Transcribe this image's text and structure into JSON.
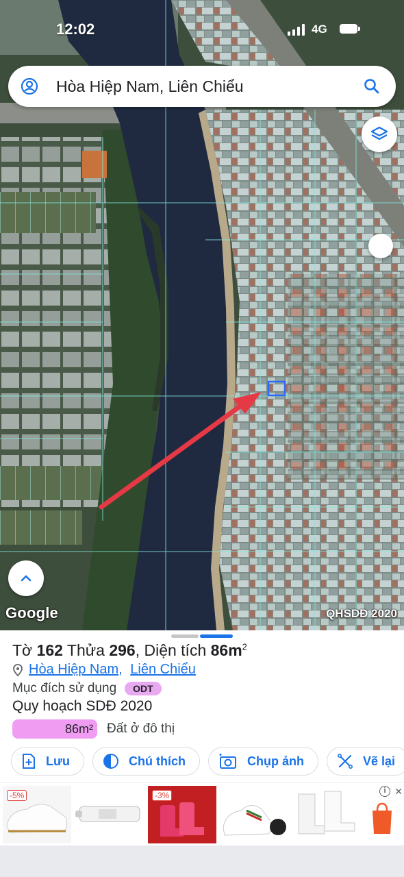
{
  "status": {
    "time": "12:02",
    "network": "4G"
  },
  "search": {
    "query": "Hòa Hiệp Nam, Liên Chiểu"
  },
  "map": {
    "attribution": "Google",
    "layer_label": "QHSDĐ 2020",
    "arrow_color": "#e53945"
  },
  "parcel": {
    "title_prefix": "Tờ",
    "sheet_no": "162",
    "parcel_prefix": "Thửa",
    "parcel_no": "296",
    "area_prefix": ", Diện tích",
    "area": "86m",
    "area_sup": "2",
    "ward": "Hòa Hiệp Nam",
    "district": "Liên Chiểu",
    "purpose_label": "Mục đích sử dụng",
    "purpose_code": "ODT",
    "plan_title": "Quy hoạch SDĐ 2020",
    "legend_value": "86m²",
    "legend_label": "Đất ở đô thị",
    "legend_color": "#f09cf2"
  },
  "actions": [
    {
      "label": "Lưu",
      "icon": "save-icon"
    },
    {
      "label": "Chú thích",
      "icon": "legend-icon"
    },
    {
      "label": "Chụp ảnh",
      "icon": "camera-icon"
    },
    {
      "label": "Vẽ lại",
      "icon": "draw-icon"
    }
  ],
  "ads": {
    "discounts": [
      "-5%",
      "-3%"
    ],
    "info": "i",
    "close": "✕"
  }
}
